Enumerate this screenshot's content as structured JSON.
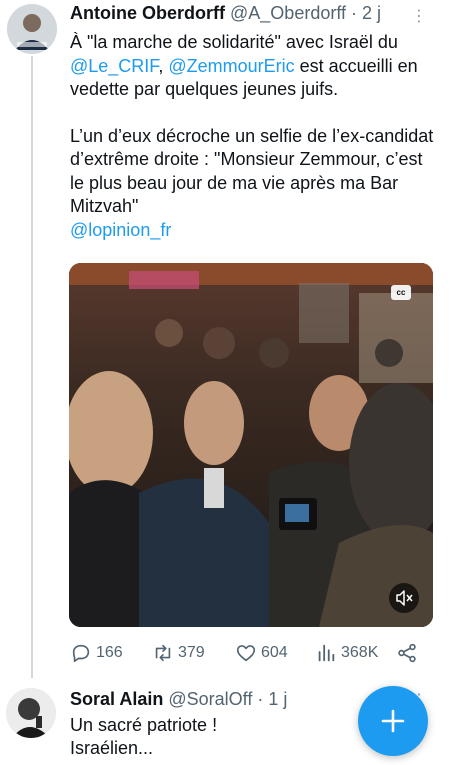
{
  "tweets": [
    {
      "author_name": "Antoine Oberdorff",
      "handle": "@A_Oberdorff",
      "time": "· 2 j",
      "more": "⋮",
      "text": {
        "p1_a": "À \"la marche de solidarité\" avec Israël du",
        "mention_1": "@Le_CRIF",
        "comma": ", ",
        "mention_2": "@ZemmourEric",
        "p1_b": " est accueilli en vedette par quelques jeunes juifs.",
        "p2": "L’un d’eux décroche un selfie de l’ex-candidat d’extrême droite : \"Monsieur Zemmour, c’est le plus beau jour de ma vie après ma Bar Mitzvah\"",
        "mention_3": "@lopinion_fr"
      },
      "media": {
        "cc_label": "cc"
      },
      "stats": {
        "replies": "166",
        "retweets": "379",
        "likes": "604",
        "views": "368K"
      }
    },
    {
      "author_name": "Soral Alain",
      "handle": "@SoralOff",
      "time": "· 1 j",
      "more": "⋮",
      "text": {
        "line1": "Un sacré patriote !",
        "line2": "Israélien..."
      }
    }
  ],
  "colors": {
    "accent": "#1d9bf0",
    "muted": "#536471",
    "text": "#0f1419",
    "thread_line": "#cfd9de"
  },
  "icons": {
    "reply": "reply-icon",
    "retweet": "retweet-icon",
    "like": "heart-icon",
    "views": "views-icon",
    "share": "share-icon",
    "compose": "plus-icon",
    "mute": "mute-icon",
    "cc": "cc-icon"
  }
}
